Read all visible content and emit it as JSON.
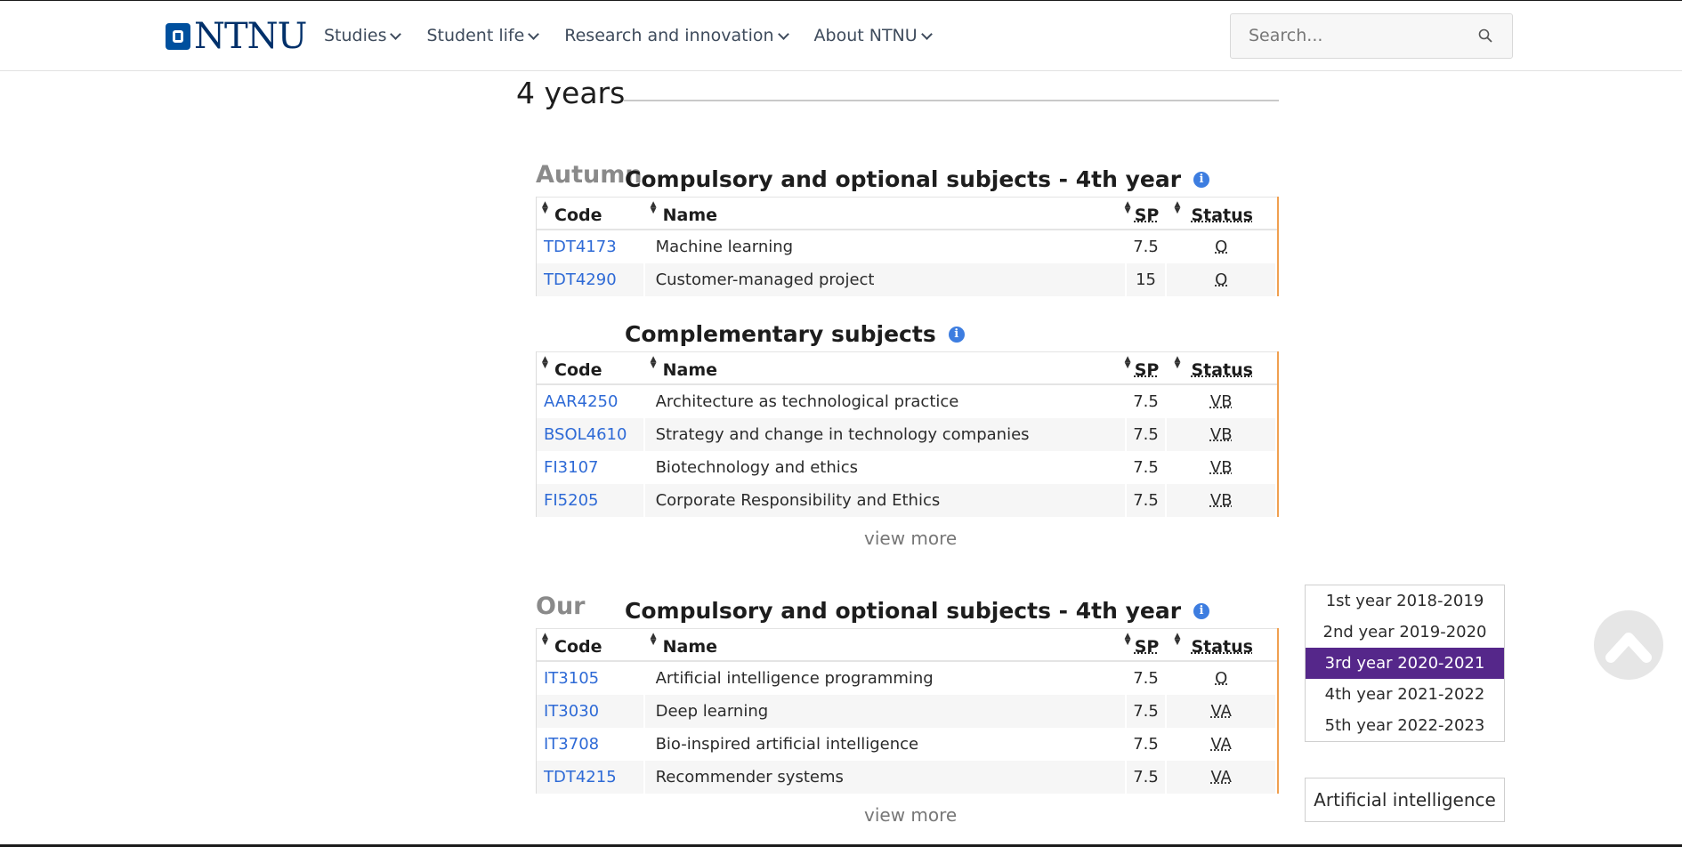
{
  "header": {
    "logo_text": "NTNU",
    "nav": [
      {
        "label": "Studies"
      },
      {
        "label": "Student life"
      },
      {
        "label": "Research and innovation"
      },
      {
        "label": "About NTNU"
      }
    ],
    "search_placeholder": "Search..."
  },
  "main": {
    "years_title": "4 years",
    "columns": {
      "code": "Code",
      "name": "Name",
      "sp": "SP",
      "status": "Status"
    },
    "sections": [
      {
        "semester": "Autumn",
        "title": "Compulsory and optional subjects - 4th year",
        "rows": [
          {
            "code": "TDT4173",
            "name": "Machine learning",
            "sp": "7.5",
            "status": "O"
          },
          {
            "code": "TDT4290",
            "name": "Customer-managed project",
            "sp": "15",
            "status": "O"
          }
        ]
      },
      {
        "semester": "",
        "title": "Complementary subjects",
        "rows": [
          {
            "code": "AAR4250",
            "name": "Architecture as technological practice",
            "sp": "7.5",
            "status": "VB"
          },
          {
            "code": "BSOL4610",
            "name": "Strategy and change in technology companies",
            "sp": "7.5",
            "status": "VB"
          },
          {
            "code": "FI3107",
            "name": "Biotechnology and ethics",
            "sp": "7.5",
            "status": "VB"
          },
          {
            "code": "FI5205",
            "name": "Corporate Responsibility and Ethics",
            "sp": "7.5",
            "status": "VB"
          }
        ],
        "view_more": "view more"
      },
      {
        "semester": "Our",
        "title": "Compulsory and optional subjects - 4th year",
        "rows": [
          {
            "code": "IT3105",
            "name": "Artificial intelligence programming",
            "sp": "7.5",
            "status": "O"
          },
          {
            "code": "IT3030",
            "name": "Deep learning",
            "sp": "7.5",
            "status": "VA"
          },
          {
            "code": "IT3708",
            "name": "Bio-inspired artificial intelligence",
            "sp": "7.5",
            "status": "VA"
          },
          {
            "code": "TDT4215",
            "name": "Recommender systems",
            "sp": "7.5",
            "status": "VA"
          }
        ],
        "view_more": "view more"
      }
    ]
  },
  "sidebar": {
    "years": [
      {
        "label": "1st year 2018-2019"
      },
      {
        "label": "2nd year 2019-2020"
      },
      {
        "label": "3rd year 2020-2021"
      },
      {
        "label": "4th year 2021-2022"
      },
      {
        "label": "5th year 2022-2023"
      }
    ],
    "active_index": 2,
    "topic_button": "Artificial intelligence"
  },
  "colors": {
    "accent": "#55278a",
    "link": "#2e6ad6",
    "brand": "#00509e",
    "table_edge": "#f0a050"
  },
  "icons": [
    "ntnu-logo-icon",
    "chevron-down-icon",
    "search-icon",
    "info-icon",
    "sort-icon",
    "scroll-top-icon"
  ]
}
